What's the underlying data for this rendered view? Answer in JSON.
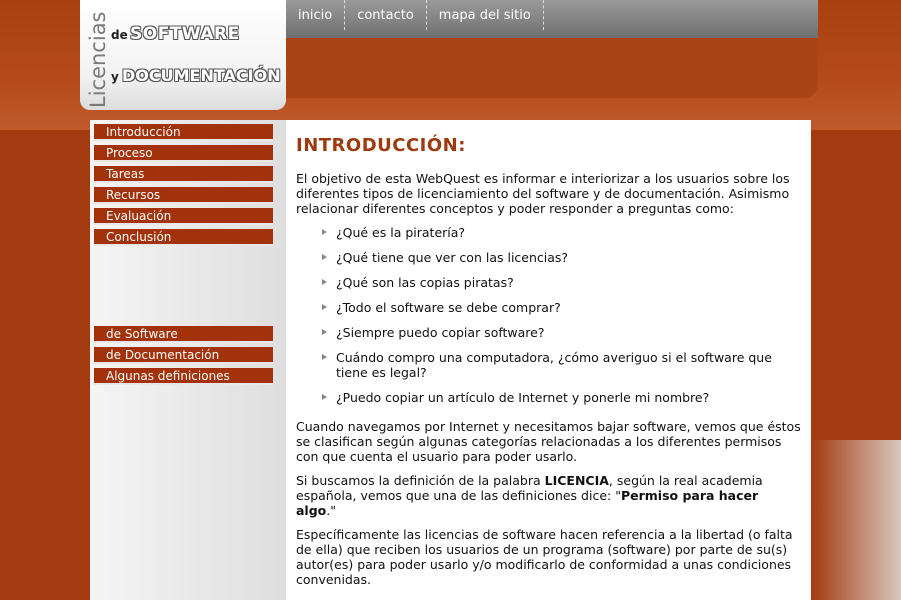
{
  "logo": {
    "vertical": "Licencias",
    "de": "de",
    "software": "SOFTWARE",
    "y": "y",
    "documentacion": "DOCUMENTACIÓN"
  },
  "topnav": [
    "inicio",
    "contacto",
    "mapa del sitio"
  ],
  "sidebar": {
    "primary": [
      "Introducción",
      "Proceso",
      "Tareas",
      "Recursos",
      "Evaluación",
      "Conclusión"
    ],
    "secondary": [
      "de Software",
      "de Documentación",
      "Algunas definiciones"
    ]
  },
  "content": {
    "title": "INTRODUCCIÓN:",
    "intro": "El objetivo de esta WebQuest es informar e interiorizar a los usuarios sobre los diferentes tipos de licenciamiento del software y de documentación. Asimismo relacionar diferentes conceptos y poder responder a preguntas como:",
    "questions": [
      "¿Qué es la piratería?",
      "¿Qué tiene que ver con las licencias?",
      "¿Qué son las copias piratas?",
      "¿Todo el software se debe comprar?",
      "¿Siempre puedo copiar software?",
      "Cuándo compro una computadora, ¿cómo averiguo si el software que tiene es legal?",
      "¿Puedo copiar un artículo de Internet y ponerle mi nombre?"
    ],
    "p2": "Cuando navegamos por Internet y necesitamos bajar software, vemos que éstos se clasifican según algunas categorías relacionadas a los diferentes permisos con que cuenta el usuario para poder usarlo.",
    "p3_pre": "Si buscamos la definición de la palabra ",
    "p3_bold1": "LICENCIA",
    "p3_mid": ", según la real academia española, vemos que una de las definiciones dice: \"",
    "p3_bold2": "Permiso para hacer algo",
    "p3_end": ".\"",
    "p4": "Específicamente las licencias de software hacen referencia a la libertad (o falta de ella) que reciben los usuarios de un programa (software) por parte de su(s) autor(es) para poder usarlo y/o modificarlo de conformidad a unas condiciones convenidas."
  }
}
